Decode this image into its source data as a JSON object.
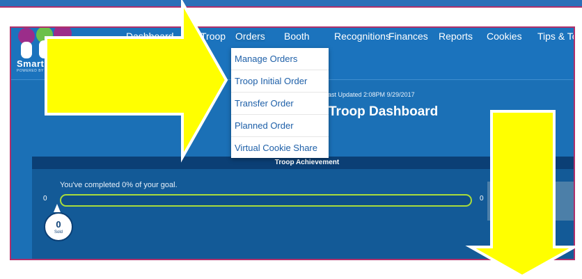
{
  "nav": {
    "items": [
      {
        "label": "Dashboard"
      },
      {
        "label": "Troop"
      },
      {
        "label": "Orders"
      },
      {
        "label": "Booth"
      },
      {
        "label": "Recognitions"
      },
      {
        "label": "Finances"
      },
      {
        "label": "Reports"
      },
      {
        "label": "Cookies"
      },
      {
        "label": "Tips & To"
      }
    ],
    "logo_text": "Smart",
    "logo_sub": "POWERED BY"
  },
  "orders_menu": {
    "items": [
      {
        "label": "Manage Orders"
      },
      {
        "label": "Troop Initial Order"
      },
      {
        "label": "Transfer Order"
      },
      {
        "label": "Planned Order"
      },
      {
        "label": "Virtual Cookie Share"
      }
    ]
  },
  "dashboard": {
    "last_updated": "Last Updated 2:08PM 9/29/2017",
    "title": "Troop Dashboard"
  },
  "achievement": {
    "header": "Troop Achievement",
    "goal_text": "You've completed 0% of your goal.",
    "progress_percent": 0,
    "min_label": "0",
    "max_label": "0",
    "sold_count": "0",
    "sold_label": "Sold"
  },
  "colors": {
    "nav_bg": "#1b73bd",
    "header_bg": "#0b3f75",
    "progress": "#a9dc3b",
    "arrow": "#ffff00",
    "frame_border": "#b0306a"
  }
}
